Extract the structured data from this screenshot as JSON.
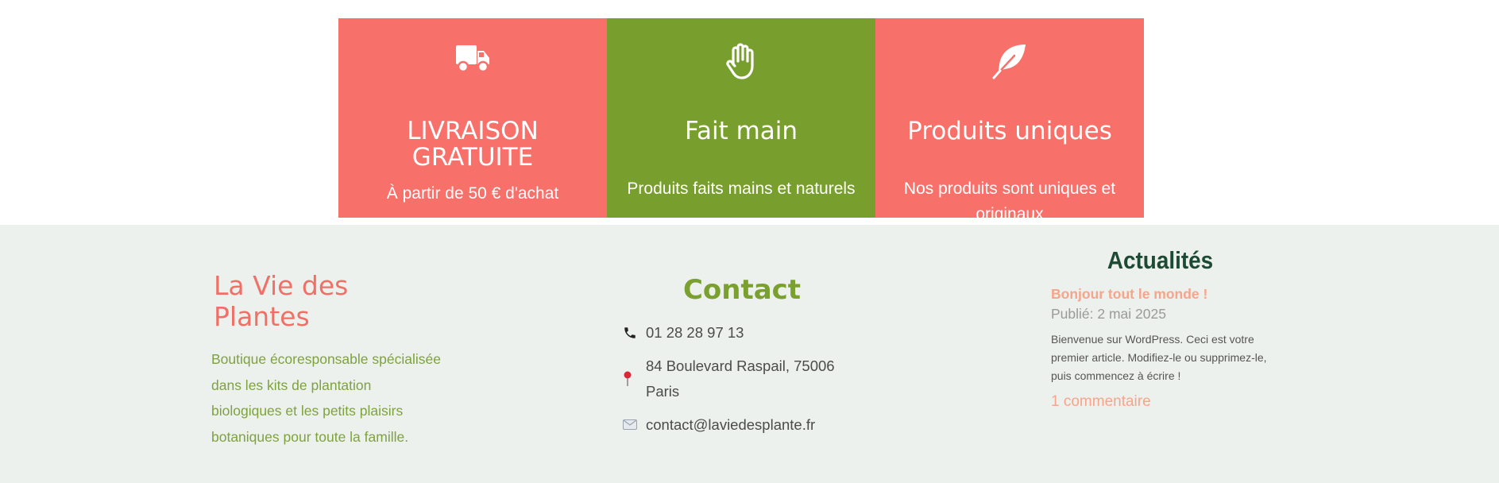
{
  "features": [
    {
      "icon": "truck-icon",
      "title": "LIVRAISON GRATUITE",
      "subtitle": "À partir de 50 € d'achat"
    },
    {
      "icon": "hand-icon",
      "title": "Fait main",
      "subtitle": "Produits faits mains et naturels"
    },
    {
      "icon": "feather-icon",
      "title": "Produits uniques",
      "subtitle": "Nos produits sont uniques et originaux"
    }
  ],
  "colors": {
    "coral": "#f8706a",
    "green": "#789f2d",
    "footer_bg": "#edf1ed",
    "brand": "#f07068",
    "dark_green": "#1d4a32",
    "peach": "#f6a48a"
  },
  "footer": {
    "brand": {
      "name": "La Vie des Plantes",
      "description": "Boutique écoresponsable spécialisée dans les kits de plantation biologiques et les petits plaisirs botaniques pour toute la famille."
    },
    "contact": {
      "title": "Contact",
      "phone": {
        "icon": "phone-icon",
        "text": "01 28 28 97 13"
      },
      "address": {
        "icon": "map-pin-icon",
        "text": "84 Boulevard Raspail, 75006 Paris"
      },
      "email": {
        "icon": "envelope-icon",
        "text": "contact@laviedesplante.fr"
      }
    },
    "news": {
      "title": "Actualités",
      "post_title": "Bonjour tout le monde !",
      "post_date": "Publié: 2 mai 2025",
      "excerpt": "Bienvenue sur WordPress. Ceci est votre premier article. Modifiez-le ou supprimez-le, puis commencez à écrire !",
      "comments": "1 commentaire"
    }
  }
}
